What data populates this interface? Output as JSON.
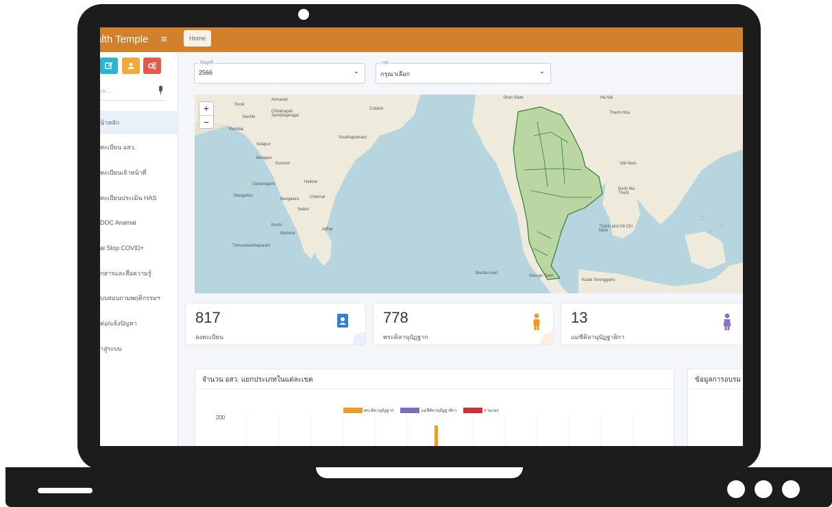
{
  "header": {
    "brand": "alth Temple",
    "menu_icon": "hamburger-icon",
    "breadcrumb": "Home"
  },
  "sidebar": {
    "quick_buttons": [
      {
        "icon": "edit-icon",
        "color": "#2ab4cf"
      },
      {
        "icon": "users-icon",
        "color": "#f2a93b"
      },
      {
        "icon": "cogs-icon",
        "color": "#e35a4c"
      }
    ],
    "search_placeholder": "ch ...",
    "items": [
      {
        "label": "น้าหลัก",
        "active": true
      },
      {
        "label": "ทะเบียน อสว."
      },
      {
        "label": "ทะเบียนเจ้าหน้าที่"
      },
      {
        "label": "ทะเบียนประเมิน HAS"
      },
      {
        "label": "DOC Anamai"
      },
      {
        "label": "ai Stop COVID+"
      },
      {
        "label": "กสารและสื่อความรู้"
      },
      {
        "label": "บบสอบถามพฤติกรรมฯ"
      },
      {
        "label": "ต่อ/แจ้งปัญหา"
      },
      {
        "label": "าสู่ระบบ"
      }
    ]
  },
  "filters": {
    "year": {
      "label": "ข้อมูลปี",
      "value": "2566"
    },
    "zone": {
      "label": "เขต",
      "value": "กรุณาเลือก"
    }
  },
  "map": {
    "zoom_in": "+",
    "zoom_out": "−",
    "labels": [
      "Surat",
      "Amravati",
      "Chhatrapati Sambhajinagar",
      "Nashik",
      "Mumbai",
      "Cuttack",
      "Visakhapatnam",
      "Solapur",
      "Belagavi",
      "Kurnool",
      "Davanagere",
      "Nellore",
      "Mangaluru",
      "Bengaluru",
      "Chennai",
      "Salem",
      "Kochi",
      "Madurai",
      "Jaffna",
      "Thiruvananthapuram",
      "Shan State",
      "Hà Nội",
      "Thanh Hóa",
      "Việt Nam",
      "Buôn Ma Thuột",
      "Thành phố Hồ Chí Minh",
      "Banda Aceh",
      "George Town",
      "Kuala Terengganu"
    ]
  },
  "stats": [
    {
      "value": "817",
      "caption": "ลงทะเบียน",
      "icon": "address-book-icon",
      "color": "#2f7fd3"
    },
    {
      "value": "778",
      "caption": "พระคิลานุปัฏฐาก",
      "icon": "monk-icon",
      "color": "#f29c1f"
    },
    {
      "value": "13",
      "caption": "แม่ชีคิลานุปัฏฐายิกา",
      "icon": "nun-icon",
      "color": "#8a72c8"
    }
  ],
  "chart_panel": {
    "title": "จำนวน อสว. แยกประเภทในแต่ละเขต",
    "y_tick": "200",
    "legend": [
      {
        "label": "พระคิลานุปัฏฐาก",
        "color": "#f29c1f"
      },
      {
        "label": "แม่ชีคิลานุปัฏฐายิกา",
        "color": "#7b6cc4"
      },
      {
        "label": "สามเณร",
        "color": "#d32f2f"
      }
    ]
  },
  "side_panel": {
    "title": "ข้อมูลการอบรม"
  }
}
